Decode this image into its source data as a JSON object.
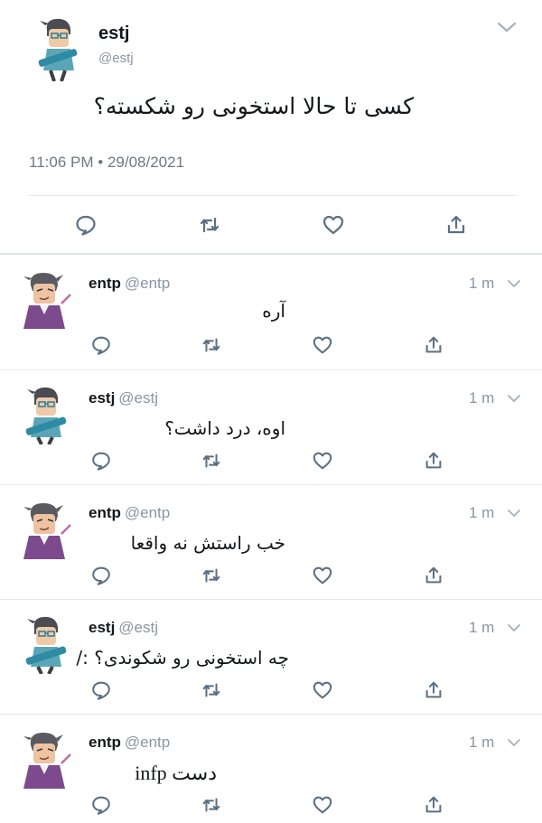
{
  "main_tweet": {
    "name": "estj",
    "handle": "@estj",
    "text": "کسی تا حالا استخونی رو شکسته؟",
    "time": "11:06 PM",
    "separator": "•",
    "date": "29/08/2021"
  },
  "replies": [
    {
      "name": "entp",
      "handle": "@entp",
      "time": "1 m",
      "text": "آره"
    },
    {
      "name": "estj",
      "handle": "@estj",
      "time": "1 m",
      "text": "اوه، درد داشت؟"
    },
    {
      "name": "entp",
      "handle": "@entp",
      "time": "1 m",
      "text": "خب راستش نه واقعا"
    },
    {
      "name": "estj",
      "handle": "@estj",
      "time": "1 m",
      "text": "چه استخونی رو شکوندی؟ :/"
    },
    {
      "name": "entp",
      "handle": "@entp",
      "time": "1 m",
      "text": "دست infp"
    }
  ],
  "icons": {
    "reply": "speech-bubble-icon",
    "retweet": "retweet-icon",
    "like": "heart-icon",
    "share": "share-icon",
    "menu": "chevron-down-icon"
  },
  "colors": {
    "text": "#14171a",
    "secondary": "#8a96a3",
    "icon": "#5b7083",
    "divider": "#e6eaed"
  }
}
